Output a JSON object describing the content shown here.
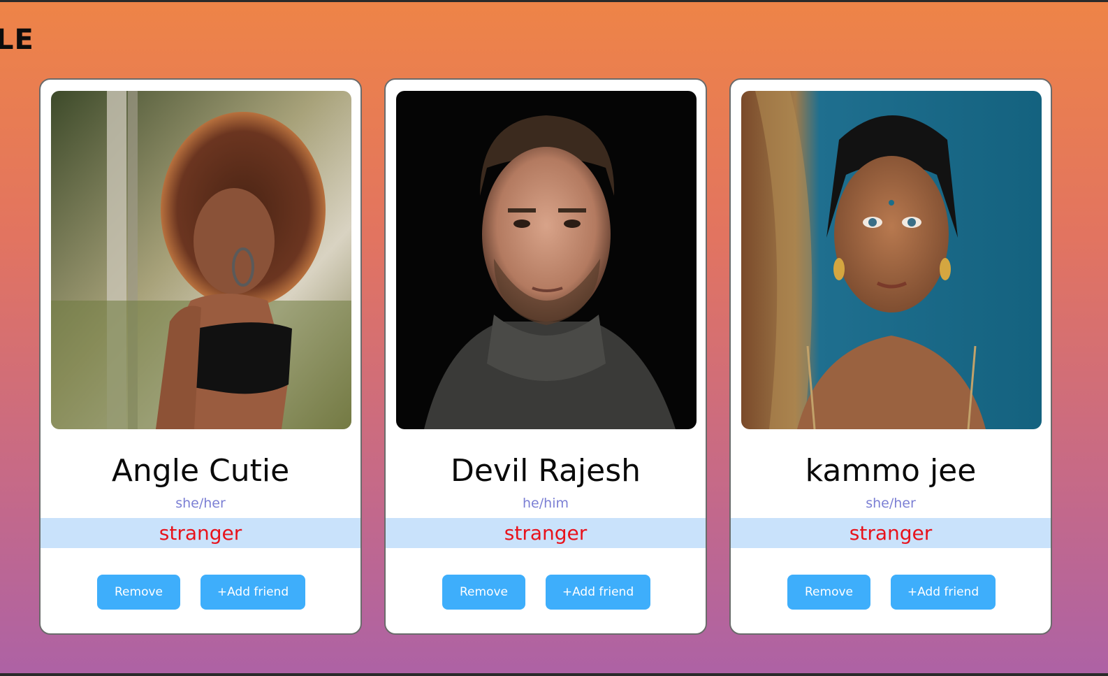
{
  "page": {
    "title": "LE"
  },
  "cards": [
    {
      "name": "Angle Cutie",
      "pronouns": "she/her",
      "status": "stranger",
      "remove_label": "Remove",
      "add_label": "+Add friend"
    },
    {
      "name": "Devil Rajesh",
      "pronouns": "he/him",
      "status": "stranger",
      "remove_label": "Remove",
      "add_label": "+Add friend"
    },
    {
      "name": "kammo jee",
      "pronouns": "she/her",
      "status": "stranger",
      "remove_label": "Remove",
      "add_label": "+Add friend"
    }
  ],
  "colors": {
    "gradient_top": "#ee8447",
    "gradient_bottom": "#ad62a5",
    "button": "#3eaefb",
    "status_band": "#c9e2fb",
    "status_text": "#e8121b",
    "pronoun_text": "#7b7fd4"
  }
}
